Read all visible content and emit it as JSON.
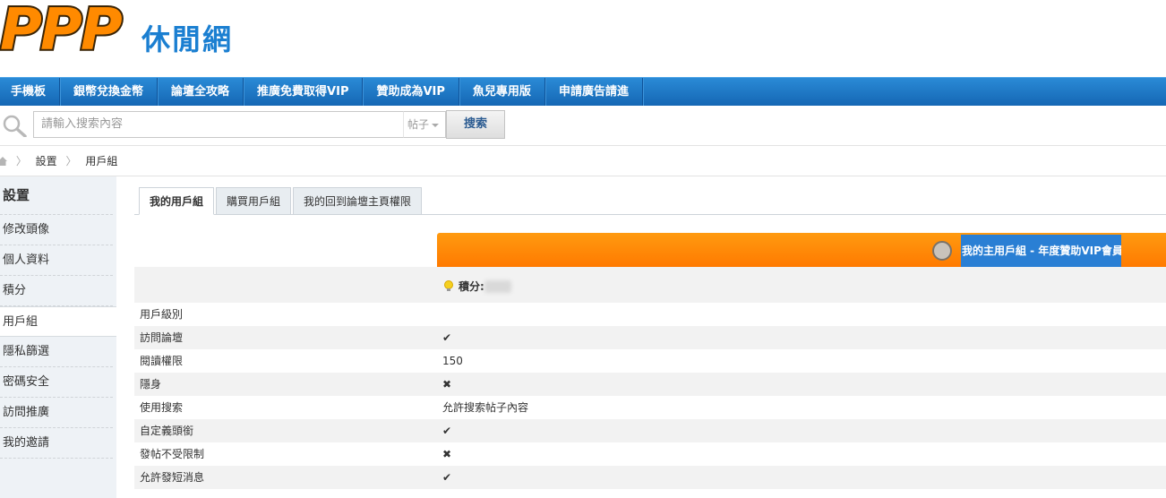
{
  "site": {
    "logo_text": "PPP",
    "logo_subtitle": "休閒網"
  },
  "nav": [
    "手機板",
    "銀幣兌換金幣",
    "論壇全攻略",
    "推廣免費取得VIP",
    "贊助成為VIP",
    "魚兒專用版",
    "申請廣告請進"
  ],
  "search": {
    "placeholder": "請輸入搜索內容",
    "type_label": "帖子",
    "button_label": "搜索"
  },
  "breadcrumb": [
    "設置",
    "用戶組"
  ],
  "sidebar": {
    "title": "設置",
    "items": [
      "修改頭像",
      "個人資料",
      "積分",
      "用戶組",
      "隱私篩選",
      "密碼安全",
      "訪問推廣",
      "我的邀請"
    ],
    "active": "用戶組"
  },
  "tabs": [
    "我的用戶組",
    "購買用戶組",
    "我的回到論壇主頁權限"
  ],
  "group": {
    "main_group_label": "我的主用戶組 - 年度贊助VIP會員",
    "points_label": "積分:"
  },
  "permissions": [
    {
      "label": "用戶級別",
      "value": ""
    },
    {
      "label": "訪問論壇",
      "value": "✔"
    },
    {
      "label": "閱讀權限",
      "value": "150"
    },
    {
      "label": "隱身",
      "value": "✖"
    },
    {
      "label": "使用搜索",
      "value": "允許搜索帖子內容"
    },
    {
      "label": "自定義頭銜",
      "value": "✔"
    },
    {
      "label": "發帖不受限制",
      "value": "✖"
    },
    {
      "label": "允許發短消息",
      "value": "✔"
    }
  ],
  "colors": {
    "nav_blue": "#1a72c2",
    "orange": "#ff8800",
    "group_blue": "#2a7fd4",
    "tick": "#3aa51f",
    "cross": "#e05a4f"
  }
}
